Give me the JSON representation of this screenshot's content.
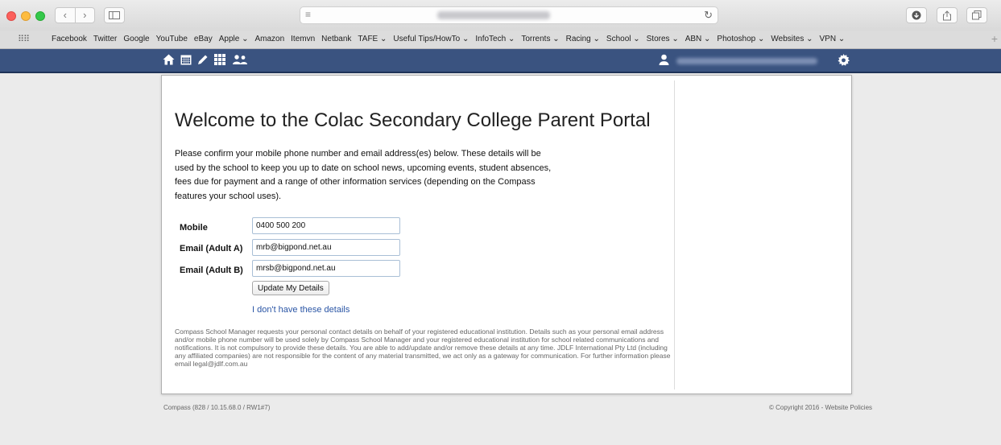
{
  "browser": {
    "nav_back_icon": "chevron-left-icon",
    "nav_forward_icon": "chevron-right-icon",
    "bookmarks": [
      "Facebook",
      "Twitter",
      "Google",
      "YouTube",
      "eBay",
      "Apple ⌄",
      "Amazon",
      "Itemvn",
      "Netbank",
      "TAFE ⌄",
      "Useful Tips/HowTo ⌄",
      "InfoTech ⌄",
      "Torrents ⌄",
      "Racing ⌄",
      "School ⌄",
      "Stores ⌄",
      "ABN ⌄",
      "Photoshop ⌄",
      "Websites ⌄",
      "VPN ⌄"
    ]
  },
  "compass_nav": {
    "bg_color": "#3a5380",
    "icons": [
      "home-icon",
      "calendar-icon",
      "pencil-icon",
      "grid-icon",
      "people-icon",
      "user-icon",
      "gear-icon"
    ]
  },
  "main": {
    "title": "Welcome to the Colac Secondary College Parent Portal",
    "intro": "Please confirm your mobile phone number and email address(es) below. These details will be used by the school to keep you up to date on school news, upcoming events, student absences, fees due for payment and a range of other information services (depending on the Compass features your school uses).",
    "form": {
      "mobile_label": "Mobile",
      "mobile_value": "0400 500 200",
      "email_a_label": "Email (Adult A)",
      "email_a_value": "mrb@bigpond.net.au",
      "email_b_label": "Email (Adult B)",
      "email_b_value": "mrsb@bigpond.net.au",
      "update_button": "Update My Details",
      "no_details_link": "I don't have these details"
    },
    "disclaimer": "Compass School Manager requests your personal contact details on behalf of your registered educational institution. Details such as your personal email address and/or mobile phone number will be used solely by Compass School Manager and your registered educational institution for school related communications and notifications. It is not compulsory to provide these details. You are able to add/update and/or remove these details at any time. JDLF International Pty Ltd (including any affiliated companies) are not responsible for the content of any material transmitted, we act only as a gateway for communication. For further information please email legal@jdlf.com.au"
  },
  "footer": {
    "left": "Compass (828 / 10.15.68.0 / RW1#7)",
    "right": "© Copyright 2016 - Website Policies"
  }
}
